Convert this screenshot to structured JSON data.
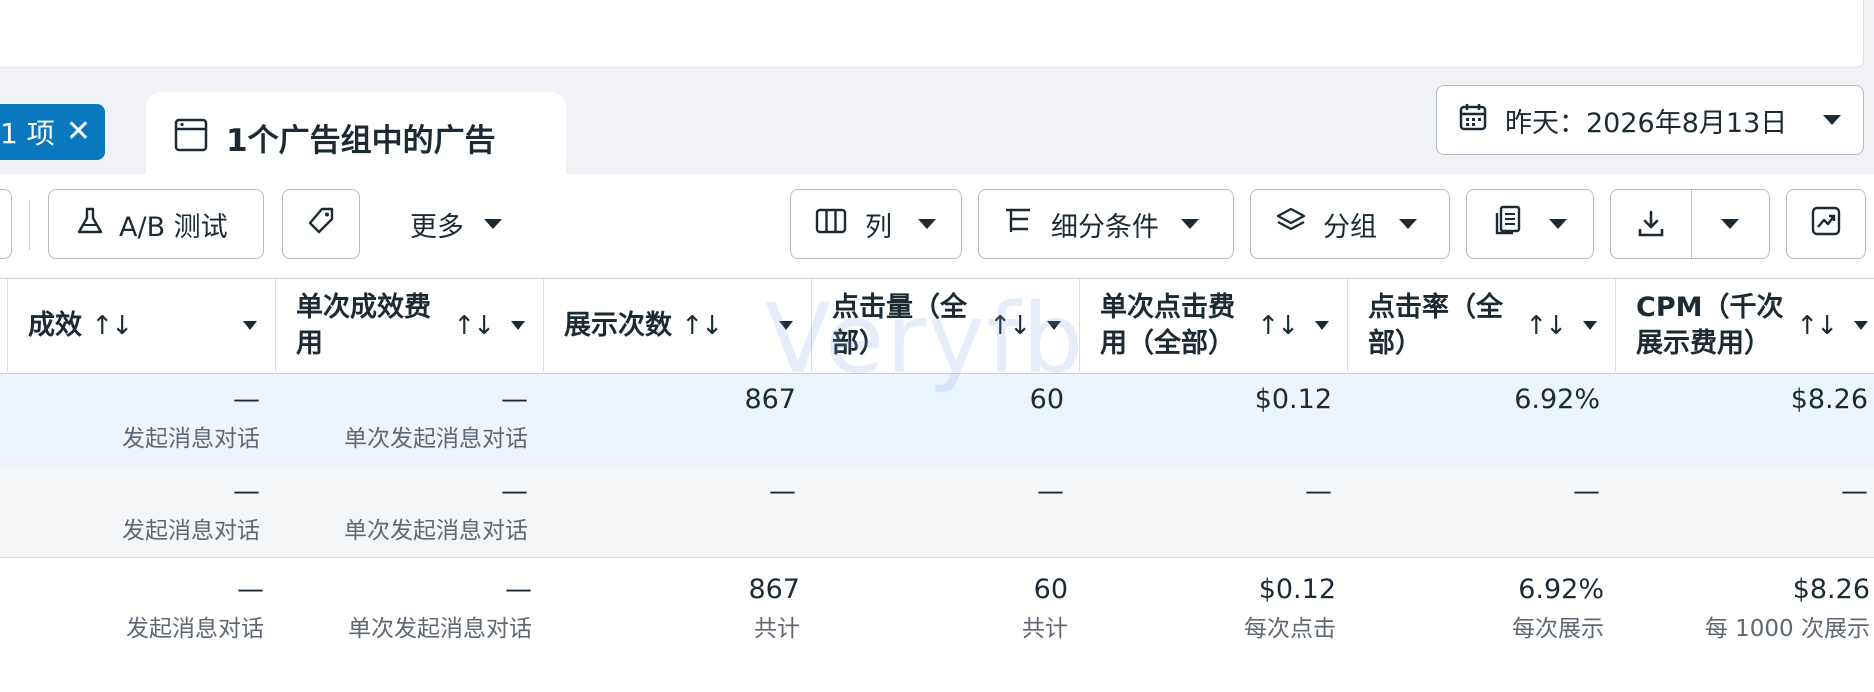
{
  "chip": {
    "label": "1 项",
    "close": "✕"
  },
  "tab": {
    "label": "1个广告组中的广告"
  },
  "date": {
    "label": "昨天：2026年8月13日"
  },
  "toolbar": {
    "ab_test": "A/B 测试",
    "more": "更多",
    "columns": "列",
    "breakdown": "细分条件",
    "group": "分组"
  },
  "headers": [
    {
      "line1": "成效",
      "line2": ""
    },
    {
      "line1": "单次成效费",
      "line2": "用"
    },
    {
      "line1": "展示次数",
      "line2": ""
    },
    {
      "line1": "点击量（全",
      "line2": "部）"
    },
    {
      "line1": "单次点击费",
      "line2": "用（全部）"
    },
    {
      "line1": "点击率（全",
      "line2": "部）"
    },
    {
      "line1": "CPM（千次",
      "line2": "展示费用）"
    }
  ],
  "sort_glyph": "↑↓",
  "rows": [
    [
      {
        "v": "—",
        "s": "发起消息对话"
      },
      {
        "v": "—",
        "s": "单次发起消息对话"
      },
      {
        "v": "867",
        "s": ""
      },
      {
        "v": "60",
        "s": ""
      },
      {
        "v": "$0.12",
        "s": ""
      },
      {
        "v": "6.92%",
        "s": ""
      },
      {
        "v": "$8.26",
        "s": ""
      }
    ],
    [
      {
        "v": "—",
        "s": "发起消息对话"
      },
      {
        "v": "—",
        "s": "单次发起消息对话"
      },
      {
        "v": "—",
        "s": ""
      },
      {
        "v": "—",
        "s": ""
      },
      {
        "v": "—",
        "s": ""
      },
      {
        "v": "—",
        "s": ""
      },
      {
        "v": "—",
        "s": ""
      }
    ],
    [
      {
        "v": "—",
        "s": "发起消息对话"
      },
      {
        "v": "—",
        "s": "单次发起消息对话"
      },
      {
        "v": "867",
        "s": "共计"
      },
      {
        "v": "60",
        "s": "共计"
      },
      {
        "v": "$0.12",
        "s": "每次点击"
      },
      {
        "v": "6.92%",
        "s": "每次展示"
      },
      {
        "v": "$8.26",
        "s": "每 1000 次展示"
      }
    ]
  ],
  "watermark": "Veryfb",
  "colors": {
    "accent": "#0a78be",
    "selected_row": "#ebf4ff",
    "muted_row": "#f5f6f7"
  }
}
